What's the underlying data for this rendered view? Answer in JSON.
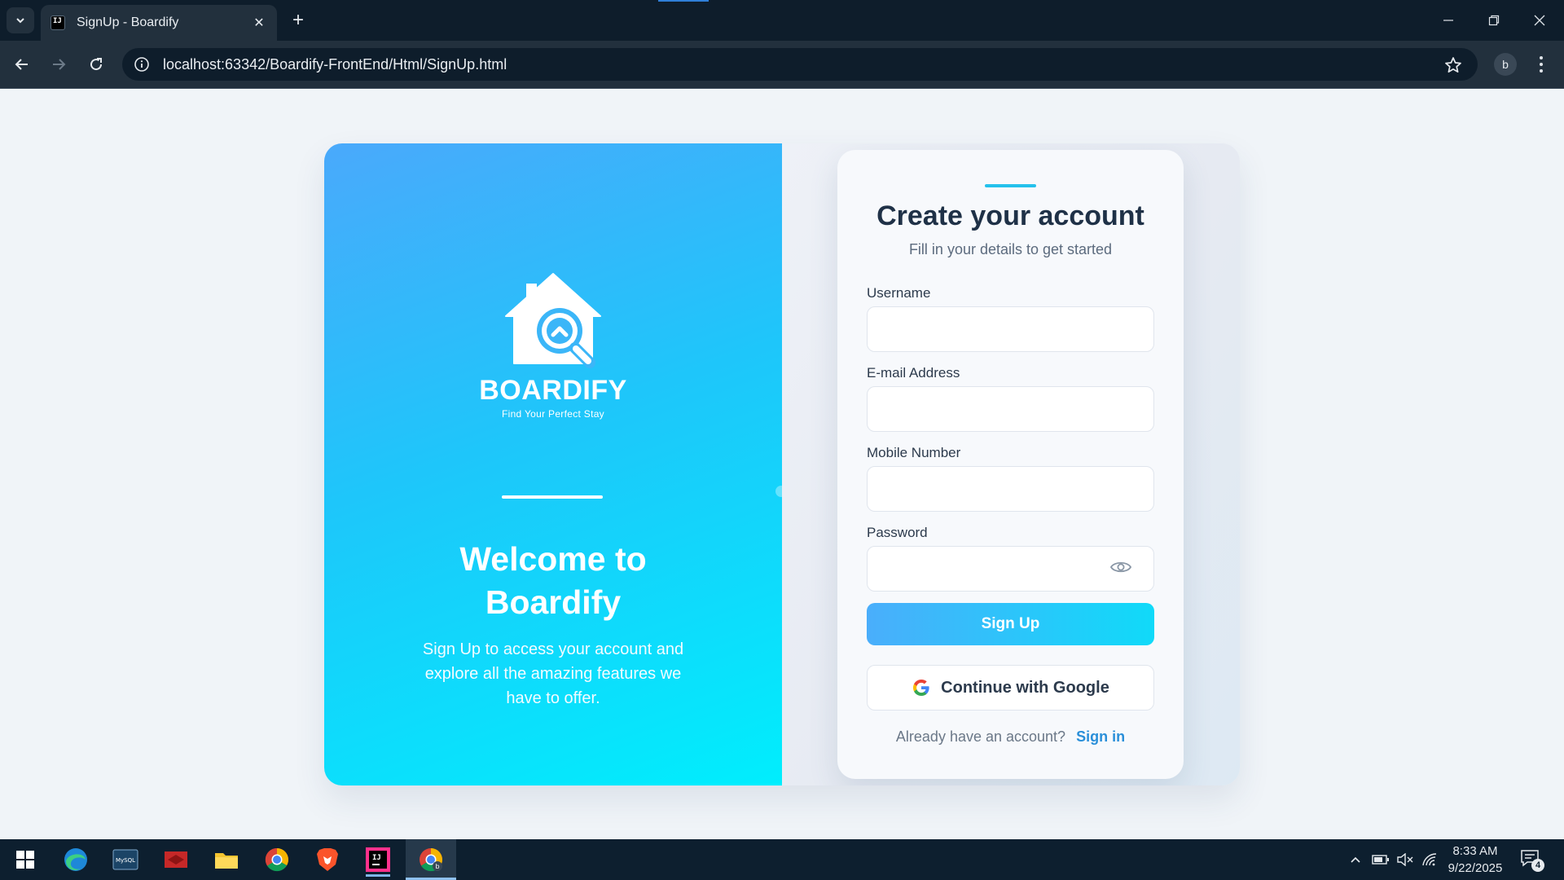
{
  "browser": {
    "tab_title": "SignUp - Boardify",
    "url": "localhost:63342/Boardify-FrontEnd/Html/SignUp.html",
    "profile_initial": "b",
    "favicon_text": "IJ"
  },
  "brand": {
    "name": "BOARDIFY",
    "tagline": "Find Your Perfect Stay"
  },
  "left_panel": {
    "welcome_line1": "Welcome to",
    "welcome_line2": "Boardify",
    "description": "Sign Up to access your account and explore all the amazing features we have to offer."
  },
  "form": {
    "title": "Create your account",
    "subtitle": "Fill in your details to get started",
    "fields": [
      {
        "label": "Username",
        "value": ""
      },
      {
        "label": "E-mail Address",
        "value": ""
      },
      {
        "label": "Mobile Number",
        "value": ""
      },
      {
        "label": "Password",
        "value": ""
      }
    ],
    "submit_label": "Sign Up",
    "google_label": "Continue with Google",
    "signin_prompt": "Already have an account?",
    "signin_link": "Sign in"
  },
  "taskbar": {
    "time": "8:33 AM",
    "date": "9/22/2025",
    "notification_count": "4",
    "mysql_label": "MySQL"
  },
  "colors": {
    "accent": "#24c1ec",
    "left_panel_start": "#4aa9fb",
    "left_panel_end": "#00eefd",
    "link": "#2a8fd9"
  }
}
